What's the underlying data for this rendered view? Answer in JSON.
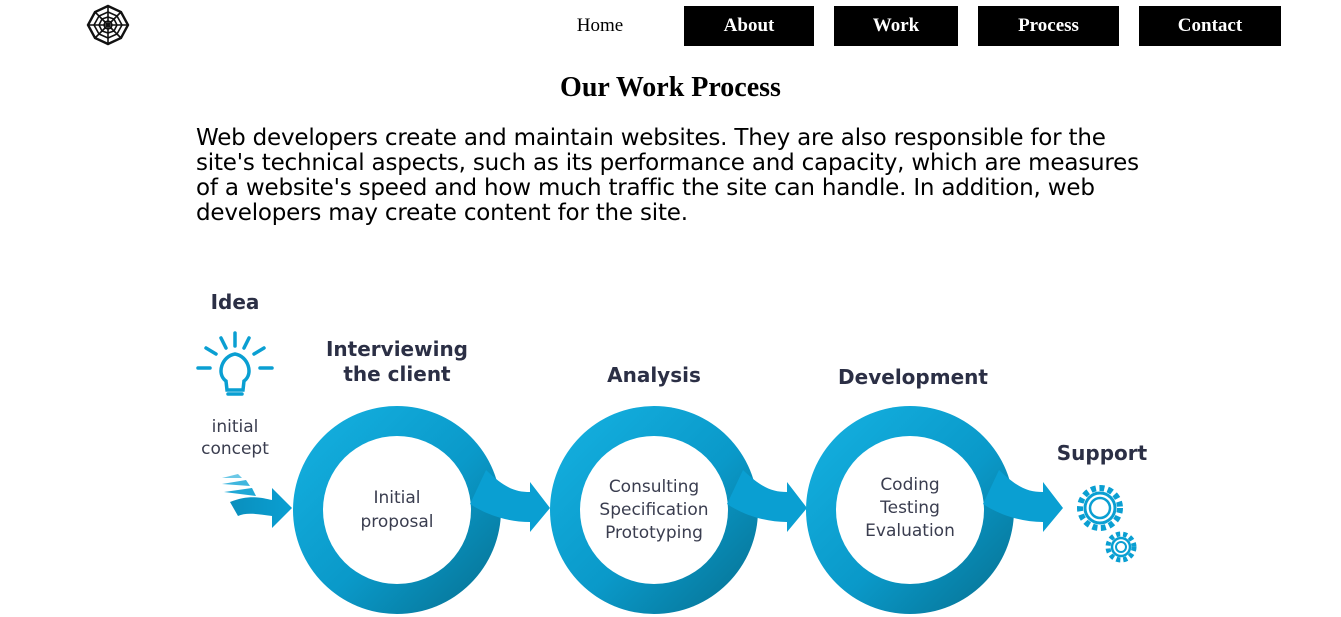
{
  "nav": {
    "home": "Home",
    "about": "About",
    "work": "Work",
    "process": "Process",
    "contact": "Contact"
  },
  "page": {
    "title": "Our Work Process",
    "intro": "Web developers create and maintain websites. They are also responsible for the site's technical aspects, such as its performance and capacity, which are measures of a website's speed and how much traffic the site can handle. In addition, web developers may create content for the site."
  },
  "process": {
    "idea": {
      "title": "Idea",
      "line1": "initial",
      "line2": "concept"
    },
    "interviewing": {
      "title1": "Interviewing",
      "title2": "the client",
      "line1": "Initial",
      "line2": "proposal"
    },
    "analysis": {
      "title": "Analysis",
      "line1": "Consulting",
      "line2": "Specification",
      "line3": "Prototyping"
    },
    "development": {
      "title": "Development",
      "line1": "Coding",
      "line2": "Testing",
      "line3": "Evaluation"
    },
    "support": {
      "title": "Support"
    }
  },
  "colors": {
    "accent": "#0a9fd2",
    "accent_dark": "#06708f",
    "heading": "#2b2f45"
  },
  "icons": [
    "spider-web-icon",
    "lightbulb-icon",
    "gears-icon"
  ]
}
